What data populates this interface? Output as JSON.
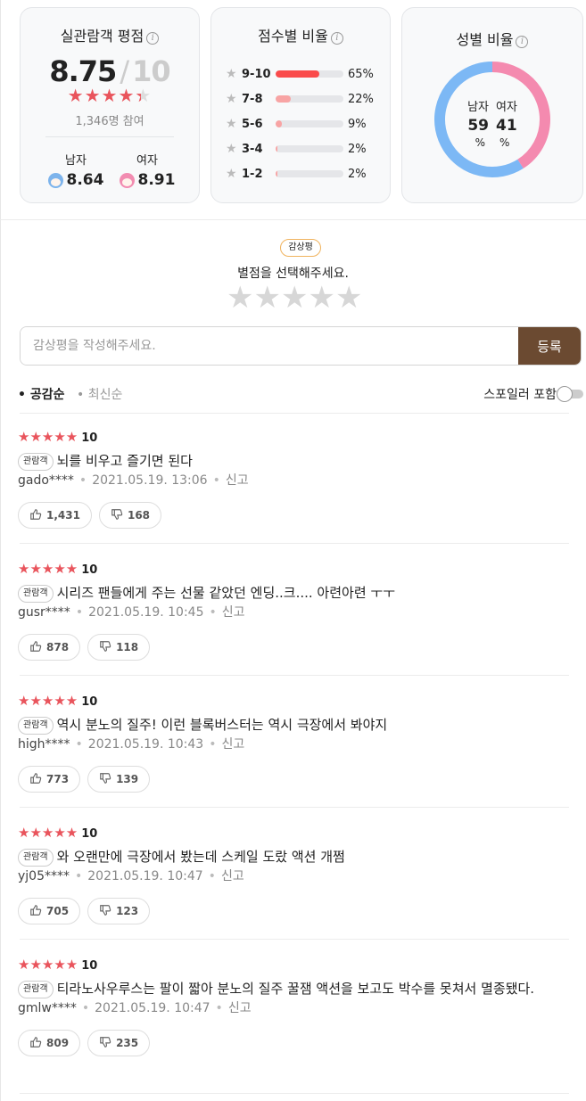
{
  "audience_rating": {
    "title": "실관람객 평점",
    "score": "8.75",
    "max": "10",
    "star_fraction": 0.875,
    "participants": "1,346명 참여",
    "male_label": "남자",
    "male_score": "8.64",
    "female_label": "여자",
    "female_score": "8.91"
  },
  "score_distribution": {
    "title": "점수별 비율",
    "rows": [
      {
        "label": "9-10",
        "percent": 65,
        "percent_text": "65%",
        "color": "#fa4b4b"
      },
      {
        "label": "7-8",
        "percent": 22,
        "percent_text": "22%",
        "color": "#f8a4a4"
      },
      {
        "label": "5-6",
        "percent": 9,
        "percent_text": "9%",
        "color": "#f8a4a4"
      },
      {
        "label": "3-4",
        "percent": 2,
        "percent_text": "2%",
        "color": "#f8a4a4"
      },
      {
        "label": "1-2",
        "percent": 2,
        "percent_text": "2%",
        "color": "#f8a4a4"
      }
    ]
  },
  "gender_ratio": {
    "title": "성별 비율",
    "male_label": "남자",
    "female_label": "여자",
    "male_value": 59,
    "female_value": 41,
    "male_text": "59",
    "female_text": "41",
    "unit": "%",
    "male_color": "#7cb8f5",
    "female_color": "#f48aaf"
  },
  "write_review": {
    "badge": "감상평",
    "prompt": "별점을 선택해주세요.",
    "placeholder": "감상평을 작성해주세요.",
    "submit_label": "등록"
  },
  "sort": {
    "active": "• 공감순",
    "inactive": "• 최신순",
    "spoiler_label": "스포일러 포함"
  },
  "reviews": [
    {
      "stars": "★★★★★",
      "score": "10",
      "badge": "관람객",
      "text": "뇌를 비우고 즐기면 된다",
      "user": "gado****",
      "date": "2021.05.19. 13:06",
      "report": "신고",
      "likes": "1,431",
      "dislikes": "168"
    },
    {
      "stars": "★★★★★",
      "score": "10",
      "badge": "관람객",
      "text": "시리즈 팬들에게 주는 선물 같았던 엔딩..크.... 아련아련 ㅜㅜ",
      "user": "gusr****",
      "date": "2021.05.19. 10:45",
      "report": "신고",
      "likes": "878",
      "dislikes": "118"
    },
    {
      "stars": "★★★★★",
      "score": "10",
      "badge": "관람객",
      "text": "역시 분노의 질주! 이런 블록버스터는 역시 극장에서 봐야지",
      "user": "high****",
      "date": "2021.05.19. 10:43",
      "report": "신고",
      "likes": "773",
      "dislikes": "139"
    },
    {
      "stars": "★★★★★",
      "score": "10",
      "badge": "관람객",
      "text": "와 오랜만에 극장에서 봤는데 스케일 도랐 액션 개쩜",
      "user": "yj05****",
      "date": "2021.05.19. 10:47",
      "report": "신고",
      "likes": "705",
      "dislikes": "123"
    },
    {
      "stars": "★★★★★",
      "score": "10",
      "badge": "관람객",
      "text": "티라노사우루스는 팔이 짧아 분노의 질주 꿀잼 액션을 보고도 박수를 못쳐서 멸종됐다.",
      "user": "gmlw****",
      "date": "2021.05.19. 10:47",
      "report": "신고",
      "likes": "809",
      "dislikes": "235"
    }
  ]
}
